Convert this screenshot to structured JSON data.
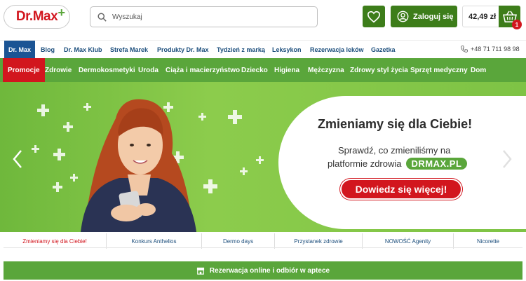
{
  "header": {
    "logo_text": "Dr.Max",
    "logo_plus": "+",
    "search_placeholder": "Wyszukaj",
    "login_label": "Zaloguj się",
    "cart_price": "42,49 zł",
    "cart_count": "1"
  },
  "topnav": {
    "items": [
      "Dr. Max",
      "Blog",
      "Dr. Max Klub",
      "Strefa Marek",
      "Produkty Dr. Max",
      "Tydzień z marką",
      "Leksykon",
      "Rezerwacja leków",
      "Gazetka"
    ],
    "phone": "+48 71 711 98 98"
  },
  "catnav": {
    "items": [
      "Promocje",
      "Zdrowie",
      "Dermokosmetyki",
      "Uroda",
      "Ciąża i macierzyństwo",
      "Dziecko",
      "Higiena",
      "Mężczyzna",
      "Zdrowy styl życia",
      "Sprzęt medyczny",
      "Dom"
    ]
  },
  "banner": {
    "headline": "Zmieniamy się dla Ciebie!",
    "line1": "Sprawdź, co zmieniliśmy na",
    "line2": "platformie zdrowia",
    "pill": "DRMAX.PL",
    "cta": "Dowiedz się więcej!"
  },
  "tabs": [
    "Zmieniamy się dla Ciebie!",
    "Konkurs Anthelios",
    "Dermo days",
    "Przystanek zdrowie",
    "NOWOŚĆ Agenity",
    "Nicorette"
  ],
  "reserve_label": "Rezerwacja online i odbiór w aptece",
  "colors": {
    "brand_red": "#d2161e",
    "brand_green": "#5aa63b",
    "dark_green": "#3d7d1a",
    "nav_blue": "#1b5494"
  },
  "icons": [
    "search-icon",
    "heart-icon",
    "user-icon",
    "basket-icon",
    "phone-icon",
    "chevron-left-icon",
    "chevron-right-icon",
    "store-icon"
  ]
}
